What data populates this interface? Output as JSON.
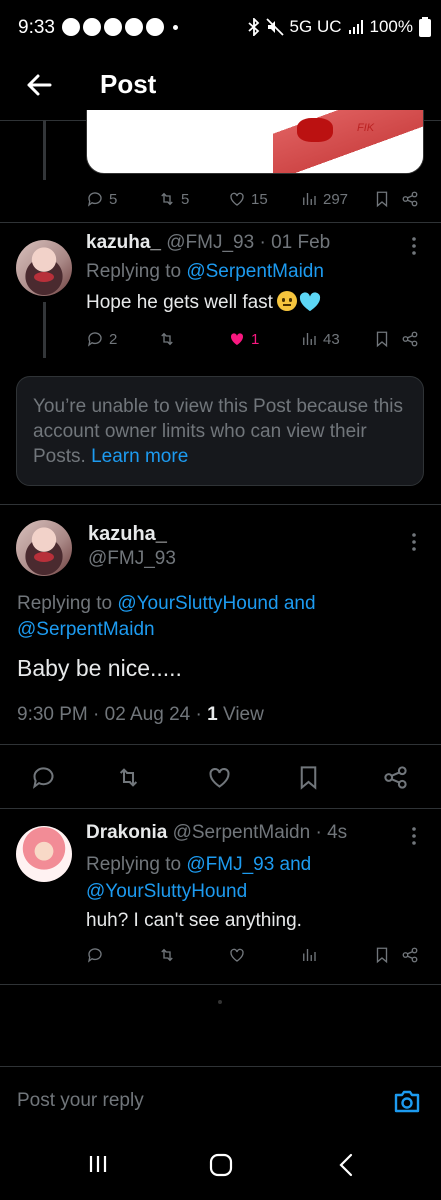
{
  "status_bar": {
    "time": "9:33",
    "network": "5G UC",
    "battery": "100%"
  },
  "header": {
    "title": "Post"
  },
  "parent_post": {
    "image_caption": "FIK",
    "replies": "5",
    "reposts": "5",
    "likes": "15",
    "views": "297"
  },
  "reply1": {
    "name": "kazuha_",
    "handle": "@FMJ_93",
    "date": "· 01 Feb",
    "replying_prefix": "Replying to",
    "replying_to": "@SerpentMaidn",
    "text": "Hope he gets well fast",
    "replies": "2",
    "likes": "1",
    "views": "43",
    "heart_color": "#f91880"
  },
  "info_box": {
    "message": "You’re unable to view this Post because this account owner limits who can view their Posts.",
    "link": "Learn more"
  },
  "main_post": {
    "name": "kazuha_",
    "handle": "@FMJ_93",
    "replying_prefix": "Replying to",
    "replying_to_1": "@YourSluttyHound",
    "and": "and",
    "replying_to_2": "@SerpentMaidn",
    "text": "Baby be nice.....",
    "timestamp": "9:30 PM · 02 Aug 24 ·",
    "view_count": "1",
    "view_label": "View"
  },
  "reply2": {
    "name": "Drakonia",
    "handle": "@SerpentMaidn",
    "time": "· 4s",
    "replying_prefix": "Replying to",
    "replying_to_1": "@FMJ_93",
    "and": "and",
    "replying_to_2": "@YourSluttyHound",
    "text": "huh? I can't see anything."
  },
  "composer": {
    "placeholder": "Post your reply"
  },
  "colors": {
    "accent": "#1d9bf0",
    "muted": "#71767b",
    "background": "#000000"
  }
}
